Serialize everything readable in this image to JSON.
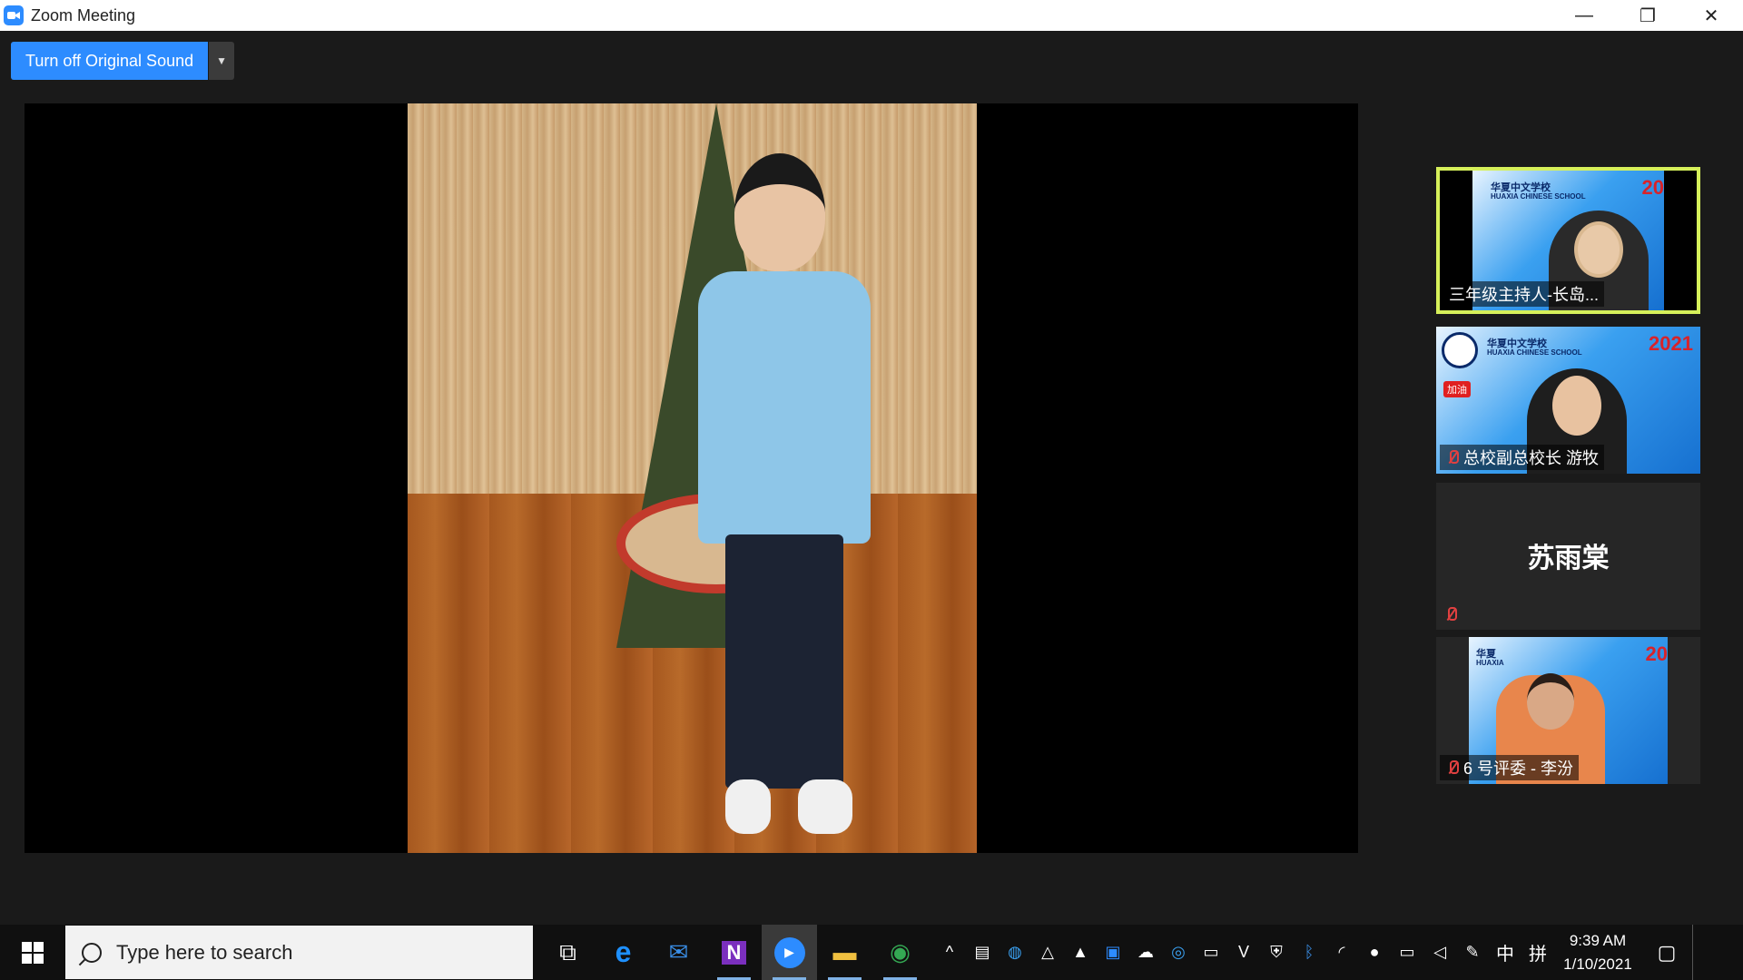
{
  "window": {
    "title": "Zoom Meeting",
    "minimize": "—",
    "restore": "❐",
    "close": "✕"
  },
  "meeting": {
    "sound_button": "Turn off Original Sound",
    "sound_caret": "▼"
  },
  "gallery": [
    {
      "name": "三年级主持人-长岛...",
      "active": true,
      "muted": false,
      "banner": "华夏中文学校",
      "banner_sub": "HUAXIA CHINESE SCHOOL",
      "year": "20"
    },
    {
      "name": "总校副总校长 游牧",
      "active": false,
      "muted": true,
      "banner": "华夏中文学校",
      "banner_sub": "HUAXIA CHINESE SCHOOL",
      "year": "2021",
      "badge": "加油"
    },
    {
      "name": "苏雨棠",
      "active": false,
      "muted": true,
      "video_off": true
    },
    {
      "name": "6 号评委 - 李汾",
      "active": false,
      "muted": true,
      "banner": "华夏",
      "banner_sub": "HUAXIA",
      "year": "20"
    }
  ],
  "taskbar": {
    "search_placeholder": "Type here to search",
    "apps": [
      {
        "icon": "task-view-icon",
        "glyph": "⧉"
      },
      {
        "icon": "edge-icon",
        "glyph": "e",
        "color": "#1e90ff"
      },
      {
        "icon": "mail-icon",
        "glyph": "✉",
        "color": "#3a8ee6"
      },
      {
        "icon": "onenote-icon",
        "glyph": "N",
        "color": "#7b2fbe"
      },
      {
        "icon": "zoom-icon",
        "glyph": "▶",
        "color": "#2d8cff"
      },
      {
        "icon": "file-explorer-icon",
        "glyph": "▬",
        "color": "#f0c040"
      },
      {
        "icon": "chrome-icon",
        "glyph": "◉",
        "color": "#34a853"
      }
    ],
    "tray_chevron": "^",
    "ime_lang": "中",
    "ime_mode": "拼",
    "time": "9:39 AM",
    "date": "1/10/2021"
  }
}
